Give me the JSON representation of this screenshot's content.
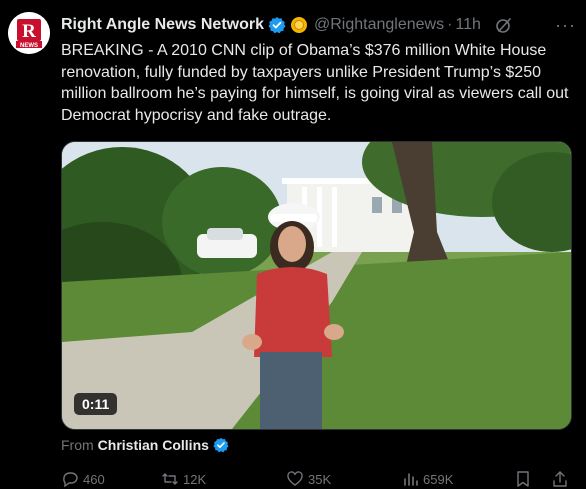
{
  "post": {
    "author_name": "Right Angle News Network",
    "handle": "@Rightanglenews",
    "separator": "·",
    "time": "11h",
    "more_label": "···",
    "text": "BREAKING - A 2010 CNN clip of Obama’s $376 million White House renovation, fully funded by taxpayers unlike President Trump’s $250 million ballroom he’s paying for himself, is going viral as viewers call out Democrat hypocrisy and fake outrage.",
    "avatar_letter": "R",
    "avatar_caption": "NEWS",
    "video_duration": "0:11",
    "from_label": "From",
    "from_name": "Christian Collins"
  },
  "actions": {
    "replies": "460",
    "reposts": "12K",
    "likes": "35K",
    "views": "659K"
  },
  "colors": {
    "background": "#000000",
    "text": "#e7e9ea",
    "muted": "#71767b",
    "verified": "#1d9bf0",
    "gold_badge": "#f4b400"
  }
}
